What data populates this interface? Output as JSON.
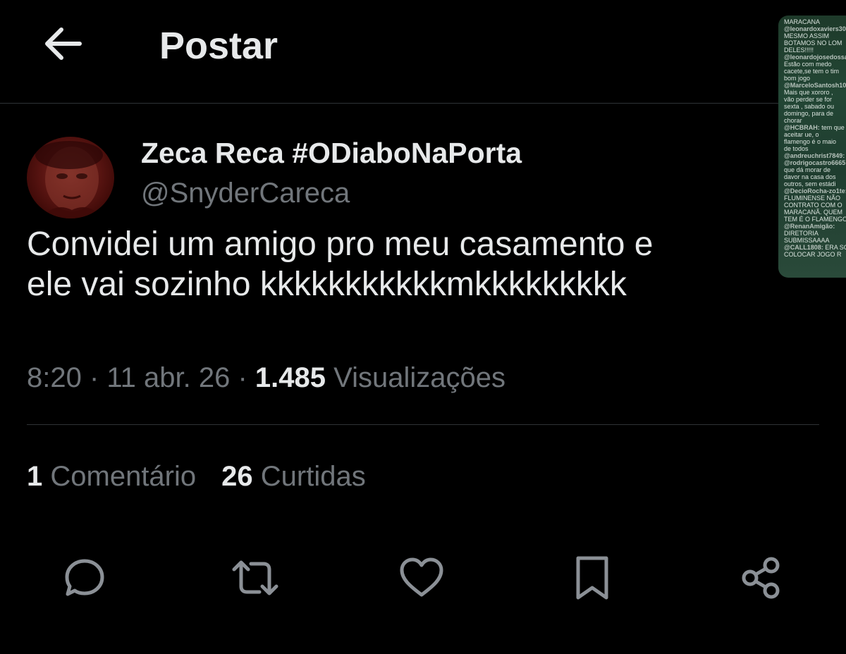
{
  "header": {
    "back_icon": "arrow-left-icon",
    "title": "Postar"
  },
  "post": {
    "author": {
      "display_name": "Zeca Reca #ODiaboNaPorta",
      "handle": "@SnyderCareca"
    },
    "text_lines": [
      "Convidei um amigo pro meu casamento e",
      "ele vai sozinho kkkkkkkkkkkmkkkkkkkkk"
    ],
    "time": "8:20",
    "date": "11 abr. 26",
    "views_count": "1.485",
    "views_label": "Visualizações",
    "stats": {
      "comments_count": "1",
      "comments_label": "Comentário",
      "likes_count": "26",
      "likes_label": "Curtidas"
    }
  },
  "actions": [
    {
      "name": "reply",
      "icon": "comment-icon"
    },
    {
      "name": "repost",
      "icon": "retweet-icon"
    },
    {
      "name": "like",
      "icon": "heart-icon"
    },
    {
      "name": "bookmark",
      "icon": "bookmark-icon"
    },
    {
      "name": "share",
      "icon": "share-icon"
    }
  ],
  "chat_overlay": {
    "lines": [
      [
        "",
        "MARACANA"
      ],
      [
        "@leonardoxaviers304:",
        ""
      ],
      [
        "",
        "MESMO ASSIM"
      ],
      [
        "",
        "BOTAMOS NO LOM"
      ],
      [
        "",
        "DELES!!!!!"
      ],
      [
        "@leonardojosedossant",
        ""
      ],
      [
        "",
        "Estão com medo"
      ],
      [
        "",
        "cacete,se tem o tim"
      ],
      [
        "",
        "bom jogo"
      ],
      [
        "@MarceloSantosh10:",
        ""
      ],
      [
        "",
        "Mais que xororo ,"
      ],
      [
        "",
        "vão perder se for"
      ],
      [
        "",
        "sexta , sabado ou"
      ],
      [
        "",
        "domingo, para de"
      ],
      [
        "",
        "chorar"
      ],
      [
        "@HCBRAH:",
        " tem que"
      ],
      [
        "",
        "aceitar ue, o"
      ],
      [
        "",
        "flamengo é o maio"
      ],
      [
        "",
        "de todos"
      ],
      [
        "@andreuchrist7849:",
        " Se"
      ],
      [
        "@rodrigocastro6665:",
        " i"
      ],
      [
        "",
        "que dá morar de"
      ],
      [
        "",
        "davor na casa dos"
      ],
      [
        "",
        "outros, sem estádi"
      ],
      [
        "@DecioRocha-zo1te:",
        " O"
      ],
      [
        "",
        "FLUMINENSE NÃO"
      ],
      [
        "",
        "CONTRATO COM O"
      ],
      [
        "",
        "MARACANÃ. QUEM"
      ],
      [
        "",
        "TEM É O FLAMENGO"
      ],
      [
        "@RenanAmigão:",
        ""
      ],
      [
        "",
        "DIRETORIA"
      ],
      [
        "",
        "SUBMISSAAAA"
      ],
      [
        "@CALL1808:",
        " ERA SO"
      ],
      [
        "",
        "COLOCAR JOGO R"
      ]
    ]
  }
}
